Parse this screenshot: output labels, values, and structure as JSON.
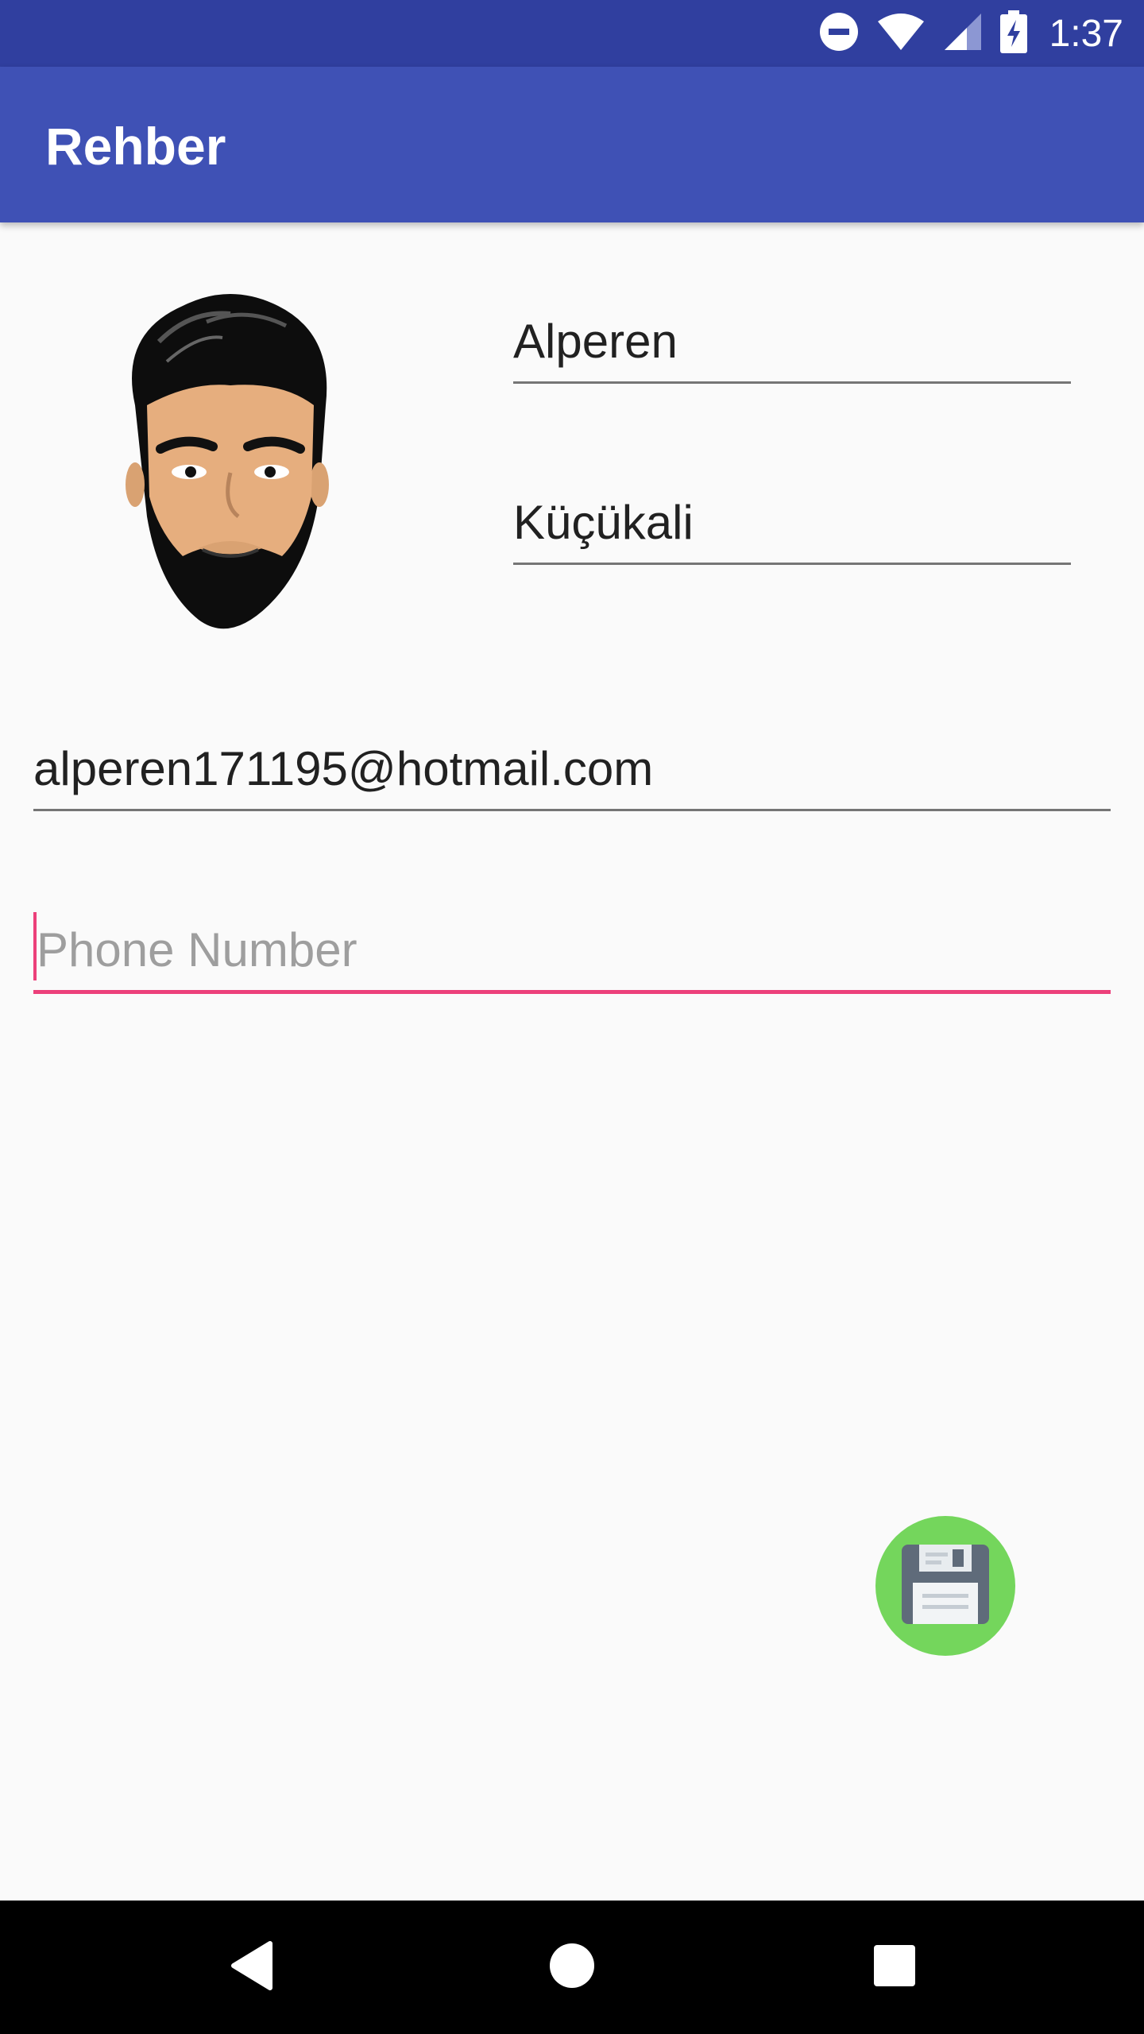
{
  "status_bar": {
    "time": "1:37",
    "icons": [
      "do-not-disturb-icon",
      "wifi-icon",
      "cell-signal-icon",
      "battery-charging-icon"
    ]
  },
  "app_bar": {
    "title": "Rehber"
  },
  "form": {
    "first_name": "Alperen",
    "last_name": "Küçükali",
    "email": "alperen171195@hotmail.com",
    "phone_placeholder": "Phone Number",
    "phone_value": ""
  },
  "fab": {
    "icon": "save-floppy-icon"
  },
  "nav_bar": {
    "icons": [
      "back-icon",
      "home-icon",
      "recents-icon"
    ]
  },
  "colors": {
    "status_bar": "#303f9f",
    "app_bar": "#3f51b5",
    "accent": "#ec407a",
    "fab": "#74d65c",
    "background": "#fafafa"
  }
}
